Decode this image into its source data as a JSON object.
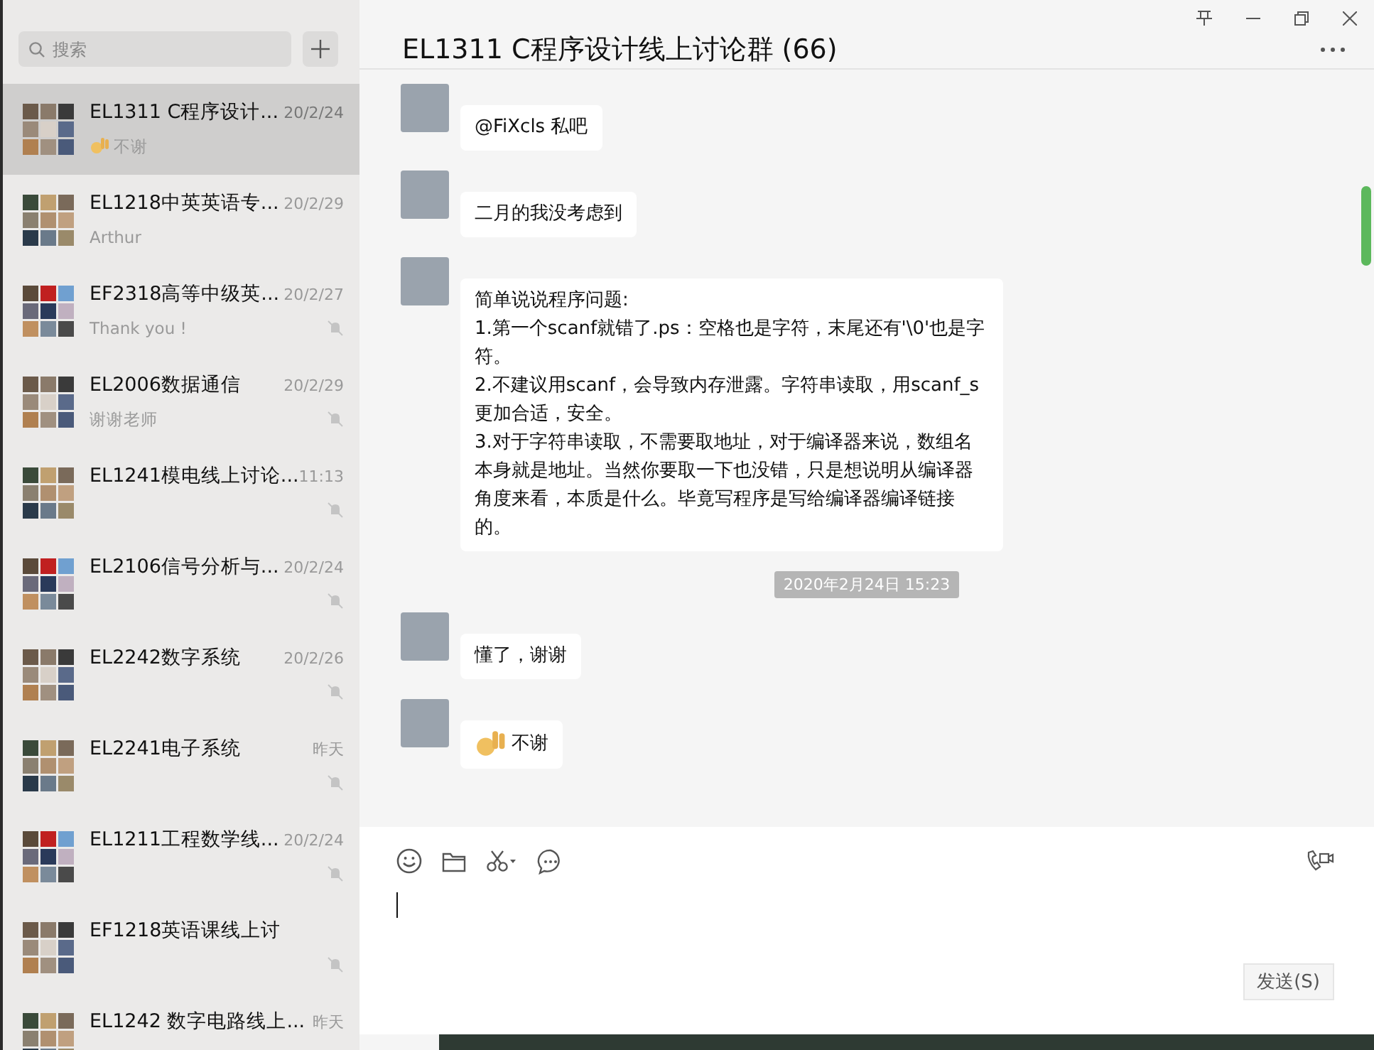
{
  "search": {
    "placeholder": "搜索"
  },
  "chats": [
    {
      "title": "EL1311 C程序设计...",
      "time": "20/2/24",
      "preview": "不谢",
      "preview_emoji": true,
      "muted": false,
      "selected": true
    },
    {
      "title": "EL1218中英英语专...",
      "time": "20/2/29",
      "preview": "Arthur",
      "preview_emoji": false,
      "muted": false,
      "selected": false
    },
    {
      "title": "EF2318高等中级英...",
      "time": "20/2/27",
      "preview": "Thank you !",
      "preview_emoji": false,
      "muted": true,
      "selected": false
    },
    {
      "title": "EL2006数据通信",
      "time": "20/2/29",
      "preview": "谢谢老师",
      "preview_emoji": false,
      "muted": true,
      "selected": false
    },
    {
      "title": "EL1241模电线上讨论...",
      "time": "11:13",
      "preview_emoji": false,
      "muted": true,
      "selected": false
    },
    {
      "title": "EL2106信号分析与...",
      "time": "20/2/24",
      "preview_emoji": false,
      "muted": true,
      "selected": false
    },
    {
      "title": "EL2242数字系统",
      "time": "20/2/26",
      "preview_emoji": false,
      "muted": true,
      "selected": false
    },
    {
      "title": "EL2241电子系统",
      "time": "昨天",
      "preview_emoji": false,
      "muted": true,
      "selected": false
    },
    {
      "title": "EL1211工程数学线...",
      "time": "20/2/24",
      "preview_emoji": false,
      "muted": true,
      "selected": false
    },
    {
      "title": "EF1218英语课线上讨",
      "preview_emoji": false,
      "muted": true,
      "selected": false
    },
    {
      "title": "EL1242 数字电路线上...",
      "time": "昨天",
      "preview_emoji": false,
      "muted": false,
      "selected": false
    }
  ],
  "chat": {
    "title": "EL1311 C程序设计线上讨论群 (66)",
    "messages": [
      {
        "kind": "text",
        "text": "@FiXcls 私吧"
      },
      {
        "kind": "text",
        "text": "二月的我没考虑到"
      },
      {
        "kind": "text",
        "text": "简单说说程序问题:\n1.第一个scanf就错了.ps：空格也是字符，末尾还有'\\0'也是字符。\n2.不建议用scanf，会导致内存泄露。字符串读取，用scanf_s更加合适，安全。\n3.对于字符串读取，不需要取地址，对于编译器来说，数组名本身就是地址。当然你要取一下也没错，只是想说明从编译器角度来看，本质是什么。毕竟写程序是写给编译器编译链接的。"
      },
      {
        "kind": "time",
        "text": "2020年2月24日 15:23"
      },
      {
        "kind": "text",
        "text": "懂了，谢谢"
      },
      {
        "kind": "emoji_text",
        "text": "不谢"
      }
    ]
  },
  "composer": {
    "send_label": "发送(S)"
  }
}
